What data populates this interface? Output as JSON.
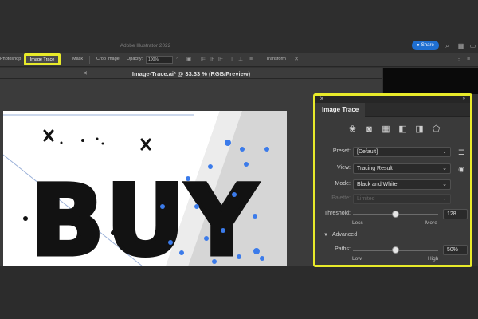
{
  "window": {
    "title": "Adobe Illustrator 2022",
    "share_label": "Share"
  },
  "controlbar": {
    "photoshop": "Photoshop",
    "image_trace": "Image Trace",
    "mask": "Mask",
    "crop_image": "Crop Image",
    "opacity_label": "Opacity:",
    "opacity_value": "100%",
    "transform": "Transform"
  },
  "document": {
    "tab_label": "Image-Trace.ai* @ 33.33 % (RGB/Preview)"
  },
  "artwork": {
    "text": "BUY"
  },
  "panel": {
    "tab": "Image Trace",
    "preset_label": "Preset:",
    "preset_value": "[Default]",
    "view_label": "View:",
    "view_value": "Tracing Result",
    "mode_label": "Mode:",
    "mode_value": "Black and White",
    "palette_label": "Palette:",
    "palette_value": "Limited",
    "threshold_label": "Threshold:",
    "threshold_value": "128",
    "threshold_fraction": 0.5,
    "less_label": "Less",
    "more_label": "More",
    "advanced_label": "Advanced",
    "paths_label": "Paths:",
    "paths_value": "50%",
    "paths_fraction": 0.5,
    "low_label": "Low",
    "high_label": "High"
  },
  "colors": {
    "highlight": "#e8ea2a",
    "share_blue": "#1f6fd1",
    "trace_blue": "#3b7bea"
  }
}
